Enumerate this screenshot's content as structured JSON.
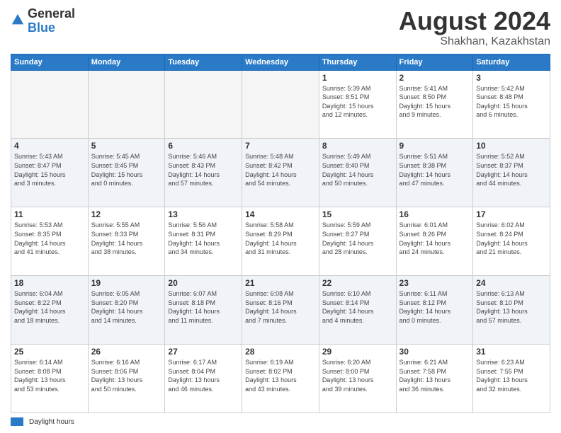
{
  "header": {
    "logo_general": "General",
    "logo_blue": "Blue",
    "main_title": "August 2024",
    "sub_title": "Shakhan, Kazakhstan"
  },
  "weekdays": [
    "Sunday",
    "Monday",
    "Tuesday",
    "Wednesday",
    "Thursday",
    "Friday",
    "Saturday"
  ],
  "weeks": [
    [
      {
        "day": "",
        "info": ""
      },
      {
        "day": "",
        "info": ""
      },
      {
        "day": "",
        "info": ""
      },
      {
        "day": "",
        "info": ""
      },
      {
        "day": "1",
        "info": "Sunrise: 5:39 AM\nSunset: 8:51 PM\nDaylight: 15 hours\nand 12 minutes."
      },
      {
        "day": "2",
        "info": "Sunrise: 5:41 AM\nSunset: 8:50 PM\nDaylight: 15 hours\nand 9 minutes."
      },
      {
        "day": "3",
        "info": "Sunrise: 5:42 AM\nSunset: 8:48 PM\nDaylight: 15 hours\nand 6 minutes."
      }
    ],
    [
      {
        "day": "4",
        "info": "Sunrise: 5:43 AM\nSunset: 8:47 PM\nDaylight: 15 hours\nand 3 minutes."
      },
      {
        "day": "5",
        "info": "Sunrise: 5:45 AM\nSunset: 8:45 PM\nDaylight: 15 hours\nand 0 minutes."
      },
      {
        "day": "6",
        "info": "Sunrise: 5:46 AM\nSunset: 8:43 PM\nDaylight: 14 hours\nand 57 minutes."
      },
      {
        "day": "7",
        "info": "Sunrise: 5:48 AM\nSunset: 8:42 PM\nDaylight: 14 hours\nand 54 minutes."
      },
      {
        "day": "8",
        "info": "Sunrise: 5:49 AM\nSunset: 8:40 PM\nDaylight: 14 hours\nand 50 minutes."
      },
      {
        "day": "9",
        "info": "Sunrise: 5:51 AM\nSunset: 8:38 PM\nDaylight: 14 hours\nand 47 minutes."
      },
      {
        "day": "10",
        "info": "Sunrise: 5:52 AM\nSunset: 8:37 PM\nDaylight: 14 hours\nand 44 minutes."
      }
    ],
    [
      {
        "day": "11",
        "info": "Sunrise: 5:53 AM\nSunset: 8:35 PM\nDaylight: 14 hours\nand 41 minutes."
      },
      {
        "day": "12",
        "info": "Sunrise: 5:55 AM\nSunset: 8:33 PM\nDaylight: 14 hours\nand 38 minutes."
      },
      {
        "day": "13",
        "info": "Sunrise: 5:56 AM\nSunset: 8:31 PM\nDaylight: 14 hours\nand 34 minutes."
      },
      {
        "day": "14",
        "info": "Sunrise: 5:58 AM\nSunset: 8:29 PM\nDaylight: 14 hours\nand 31 minutes."
      },
      {
        "day": "15",
        "info": "Sunrise: 5:59 AM\nSunset: 8:27 PM\nDaylight: 14 hours\nand 28 minutes."
      },
      {
        "day": "16",
        "info": "Sunrise: 6:01 AM\nSunset: 8:26 PM\nDaylight: 14 hours\nand 24 minutes."
      },
      {
        "day": "17",
        "info": "Sunrise: 6:02 AM\nSunset: 8:24 PM\nDaylight: 14 hours\nand 21 minutes."
      }
    ],
    [
      {
        "day": "18",
        "info": "Sunrise: 6:04 AM\nSunset: 8:22 PM\nDaylight: 14 hours\nand 18 minutes."
      },
      {
        "day": "19",
        "info": "Sunrise: 6:05 AM\nSunset: 8:20 PM\nDaylight: 14 hours\nand 14 minutes."
      },
      {
        "day": "20",
        "info": "Sunrise: 6:07 AM\nSunset: 8:18 PM\nDaylight: 14 hours\nand 11 minutes."
      },
      {
        "day": "21",
        "info": "Sunrise: 6:08 AM\nSunset: 8:16 PM\nDaylight: 14 hours\nand 7 minutes."
      },
      {
        "day": "22",
        "info": "Sunrise: 6:10 AM\nSunset: 8:14 PM\nDaylight: 14 hours\nand 4 minutes."
      },
      {
        "day": "23",
        "info": "Sunrise: 6:11 AM\nSunset: 8:12 PM\nDaylight: 14 hours\nand 0 minutes."
      },
      {
        "day": "24",
        "info": "Sunrise: 6:13 AM\nSunset: 8:10 PM\nDaylight: 13 hours\nand 57 minutes."
      }
    ],
    [
      {
        "day": "25",
        "info": "Sunrise: 6:14 AM\nSunset: 8:08 PM\nDaylight: 13 hours\nand 53 minutes."
      },
      {
        "day": "26",
        "info": "Sunrise: 6:16 AM\nSunset: 8:06 PM\nDaylight: 13 hours\nand 50 minutes."
      },
      {
        "day": "27",
        "info": "Sunrise: 6:17 AM\nSunset: 8:04 PM\nDaylight: 13 hours\nand 46 minutes."
      },
      {
        "day": "28",
        "info": "Sunrise: 6:19 AM\nSunset: 8:02 PM\nDaylight: 13 hours\nand 43 minutes."
      },
      {
        "day": "29",
        "info": "Sunrise: 6:20 AM\nSunset: 8:00 PM\nDaylight: 13 hours\nand 39 minutes."
      },
      {
        "day": "30",
        "info": "Sunrise: 6:21 AM\nSunset: 7:58 PM\nDaylight: 13 hours\nand 36 minutes."
      },
      {
        "day": "31",
        "info": "Sunrise: 6:23 AM\nSunset: 7:55 PM\nDaylight: 13 hours\nand 32 minutes."
      }
    ]
  ],
  "footer": {
    "legend_label": "Daylight hours"
  }
}
